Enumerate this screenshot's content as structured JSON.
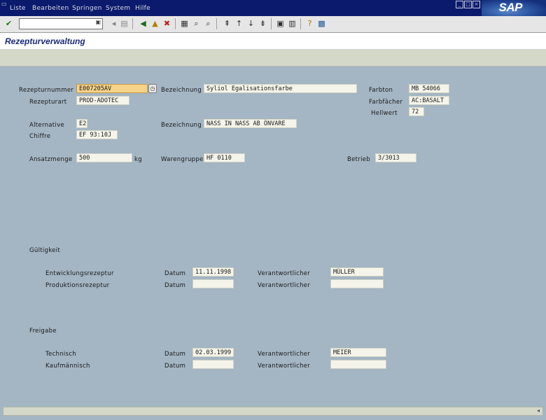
{
  "menubar": {
    "items": [
      "Liste",
      "Bearbeiten",
      "Springen",
      "System",
      "Hilfe"
    ]
  },
  "logo": {
    "text": "SAP"
  },
  "toolbar": {
    "icons": [
      "enter-icon",
      "save-icon",
      "back-icon",
      "exit-icon",
      "cancel-icon",
      "print-icon",
      "find-icon",
      "find-next-icon",
      "first-page-icon",
      "previous-page-icon",
      "next-page-icon",
      "last-page-icon",
      "create-session-icon",
      "shortcut-icon",
      "help-icon",
      "layout-icon"
    ]
  },
  "page": {
    "title": "Rezepturverwaltung"
  },
  "header": {
    "rezepturnummer": {
      "label": "Rezepturnummer",
      "value": "E007205AV"
    },
    "rezepturart": {
      "label": "Rezepturart",
      "value": "PROD-ADOTEC"
    },
    "bezeichnung1": {
      "label": "Bezeichnung",
      "value": "Syliol Egalisationsfarbe"
    },
    "farbton": {
      "label": "Farbton",
      "value": "MB 54066"
    },
    "farbfaechner": {
      "label": "Farbfächer",
      "value": "AC:BASALT"
    },
    "hellwert": {
      "label": "Hellwert",
      "value": "72"
    },
    "alternative": {
      "label": "Alternative",
      "value": "E2"
    },
    "bezeichnung2": {
      "label": "Bezeichnung",
      "value": "NASS IN NASS  AB ÖNVARE"
    },
    "chiffre": {
      "label": "Chiffre",
      "value": "EF 93:10J"
    },
    "ansatzmenge": {
      "label": "Ansatzmenge",
      "value": "500",
      "unit": "kg"
    },
    "warengruppe": {
      "label": "Warengruppe",
      "value": "HF 0110"
    },
    "betrieb": {
      "label": "Betrieb",
      "value": "3/3013"
    }
  },
  "gueltigkeit": {
    "title": "Gültigkeit",
    "rows": [
      {
        "label": "Entwicklungsrezeptur",
        "datum_label": "Datum",
        "datum": "11.11.1998",
        "verantw_label": "Verantwortlicher",
        "verantw": "MÜLLER"
      },
      {
        "label": "Produktionsrezeptur",
        "datum_label": "Datum",
        "datum": "",
        "verantw_label": "Verantwortlicher",
        "verantw": ""
      }
    ]
  },
  "freigabe": {
    "title": "Freigabe",
    "rows": [
      {
        "label": "Technisch",
        "datum_label": "Datum",
        "datum": "02.03.1999",
        "verantw_label": "Verantwortlicher",
        "verantw": "MEIER"
      },
      {
        "label": "Kaufmännisch",
        "datum_label": "Datum",
        "datum": "",
        "verantw_label": "Verantwortlicher",
        "verantw": ""
      }
    ]
  }
}
